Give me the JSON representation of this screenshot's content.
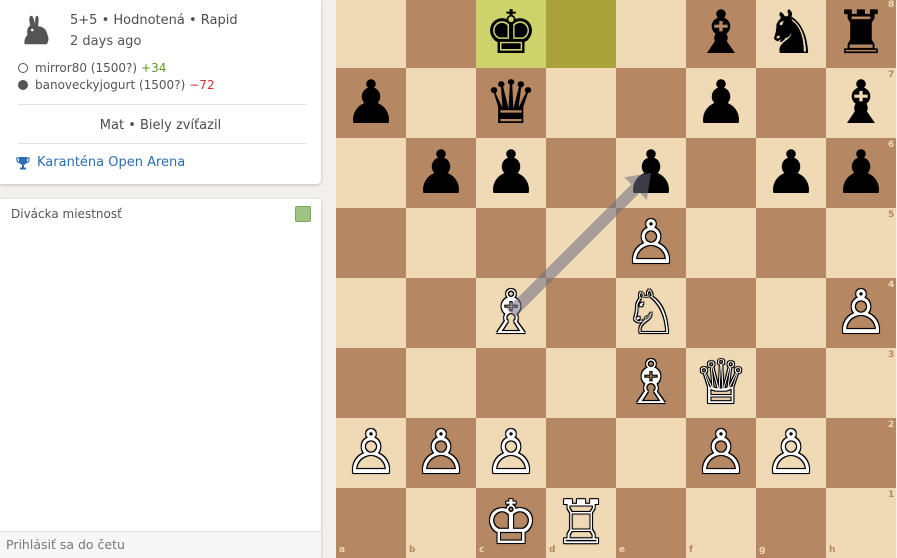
{
  "game": {
    "meta": "5+5 • Hodnotená • Rapid",
    "ago": "2 days ago",
    "white": {
      "name": "mirror80 (1500?)",
      "diff": "+34"
    },
    "black": {
      "name": "banoveckyjogurt (1500?)",
      "diff": "−72"
    },
    "result": "Mat • Biely zvíťazil",
    "tournament": "Karanténa Open Arena"
  },
  "chat": {
    "title": "Divácka miestnosť",
    "input_placeholder": "Prihlásiť sa do četu"
  },
  "colors": {
    "light": "#f0d9b5",
    "dark": "#b58863",
    "highlight_light": "#cdd26a",
    "highlight_dark": "#aaa23a",
    "link": "#2b6db3"
  },
  "board": {
    "files": [
      "a",
      "b",
      "c",
      "d",
      "e",
      "f",
      "g",
      "h"
    ],
    "ranks": [
      "8",
      "7",
      "6",
      "5",
      "4",
      "3",
      "2",
      "1"
    ],
    "highlight": [
      "c8",
      "d8"
    ],
    "arrow": {
      "from": "c4",
      "to": "e6"
    },
    "pieces": [
      {
        "sq": "c8",
        "p": "♚",
        "c": "b"
      },
      {
        "sq": "f8",
        "p": "♝",
        "c": "b"
      },
      {
        "sq": "g8",
        "p": "♞",
        "c": "b"
      },
      {
        "sq": "h8",
        "p": "♜",
        "c": "b"
      },
      {
        "sq": "a7",
        "p": "♟",
        "c": "b"
      },
      {
        "sq": "c7",
        "p": "♛",
        "c": "b"
      },
      {
        "sq": "f7",
        "p": "♟",
        "c": "b"
      },
      {
        "sq": "h7",
        "p": "♝",
        "c": "b"
      },
      {
        "sq": "b6",
        "p": "♟",
        "c": "b"
      },
      {
        "sq": "c6",
        "p": "♟",
        "c": "b"
      },
      {
        "sq": "e6",
        "p": "♟",
        "c": "b"
      },
      {
        "sq": "g6",
        "p": "♟",
        "c": "b"
      },
      {
        "sq": "h6",
        "p": "♟",
        "c": "b"
      },
      {
        "sq": "e5",
        "p": "♙",
        "c": "w"
      },
      {
        "sq": "c4",
        "p": "♗",
        "c": "w"
      },
      {
        "sq": "e4",
        "p": "♘",
        "c": "w"
      },
      {
        "sq": "h4",
        "p": "♙",
        "c": "w"
      },
      {
        "sq": "e3",
        "p": "♗",
        "c": "w"
      },
      {
        "sq": "f3",
        "p": "♕",
        "c": "w"
      },
      {
        "sq": "a2",
        "p": "♙",
        "c": "w"
      },
      {
        "sq": "b2",
        "p": "♙",
        "c": "w"
      },
      {
        "sq": "c2",
        "p": "♙",
        "c": "w"
      },
      {
        "sq": "f2",
        "p": "♙",
        "c": "w"
      },
      {
        "sq": "g2",
        "p": "♙",
        "c": "w"
      },
      {
        "sq": "c1",
        "p": "♔",
        "c": "w"
      },
      {
        "sq": "d1",
        "p": "♖",
        "c": "w"
      }
    ]
  }
}
